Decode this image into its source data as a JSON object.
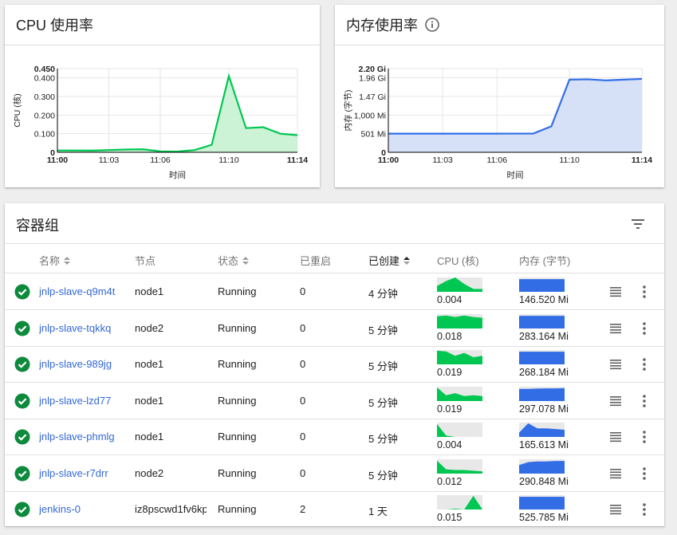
{
  "cpu_card": {
    "title": "CPU 使用率"
  },
  "mem_card": {
    "title": "内存使用率"
  },
  "chart_data": [
    {
      "type": "area",
      "title": "CPU 使用率",
      "xlabel": "时间",
      "ylabel": "CPU (核)",
      "x": [
        "11:00",
        "11:01",
        "11:02",
        "11:03",
        "11:04",
        "11:05",
        "11:06",
        "11:07",
        "11:08",
        "11:09",
        "11:10",
        "11:11",
        "11:12",
        "11:13",
        "11:14"
      ],
      "series": [
        {
          "values": [
            0.01,
            0.01,
            0.009,
            0.012,
            0.015,
            0.016,
            0.005,
            0.004,
            0.012,
            0.04,
            0.41,
            0.13,
            0.135,
            0.1,
            0.092
          ]
        }
      ],
      "yticks": [
        "0",
        "0.100",
        "0.200",
        "0.300",
        "0.400",
        "0.450"
      ],
      "ytick_values": [
        0,
        0.1,
        0.2,
        0.3,
        0.4,
        0.45
      ],
      "xticks": [
        "11:00",
        "11:03",
        "11:06",
        "11:10",
        "11:14"
      ],
      "ylim": [
        0,
        0.45
      ],
      "grid": true,
      "color": "#00c752",
      "fill": "#ccf3d6"
    },
    {
      "type": "area",
      "title": "内存使用率",
      "xlabel": "时间",
      "ylabel": "内存 (字节)",
      "x": [
        "11:00",
        "11:01",
        "11:02",
        "11:03",
        "11:04",
        "11:05",
        "11:06",
        "11:07",
        "11:08",
        "11:09",
        "11:10",
        "11:11",
        "11:12",
        "11:13",
        "11:14"
      ],
      "series": [
        {
          "values": [
            501,
            501,
            501,
            501,
            501,
            501,
            502,
            503,
            503,
            700,
            1955,
            1965,
            1935,
            1955,
            1975
          ]
        }
      ],
      "yticks": [
        "0",
        "501 Mi",
        "1,000 Mi",
        "1.47 Gi",
        "1.96 Gi",
        "2.20 Gi"
      ],
      "ytick_values": [
        0,
        501,
        1000,
        1505,
        2007,
        2253
      ],
      "xticks": [
        "11:00",
        "11:03",
        "11:06",
        "11:10",
        "11:14"
      ],
      "ylim": [
        0,
        2253
      ],
      "grid": true,
      "color": "#326de6",
      "fill": "#d6e1f8"
    }
  ],
  "pods": {
    "title": "容器组",
    "columns": {
      "name": "名称",
      "node": "节点",
      "status": "状态",
      "restarts": "已重启",
      "created": "已创建",
      "cpu": "CPU (核)",
      "memory": "内存 (字节)"
    },
    "colors": {
      "cpu_spark": "#00c752",
      "mem_spark": "#326de6",
      "spark_bg": "#e8e8e8",
      "ok": "#0d8a3c"
    },
    "rows": [
      {
        "name": "jnlp-slave-q9m4t",
        "node": "node1",
        "status": "Running",
        "restarts": "0",
        "created": "4 分钟",
        "cpu": "0.004",
        "memory": "146.520 Mi",
        "cpu_spark": [
          0.4,
          0.75,
          1.0,
          0.55,
          0.2,
          0.2
        ],
        "mem_spark": [
          0.88,
          0.88,
          0.88,
          0.88,
          0.88,
          0.88
        ]
      },
      {
        "name": "jnlp-slave-tqkkq",
        "node": "node2",
        "status": "Running",
        "restarts": "0",
        "created": "5 分钟",
        "cpu": "0.018",
        "memory": "283.164 Mi",
        "cpu_spark": [
          0.85,
          0.9,
          0.8,
          0.9,
          0.8,
          0.75
        ],
        "mem_spark": [
          0.88,
          0.88,
          0.88,
          0.88,
          0.88,
          0.88
        ]
      },
      {
        "name": "jnlp-slave-989jg",
        "node": "node1",
        "status": "Running",
        "restarts": "0",
        "created": "5 分钟",
        "cpu": "0.019",
        "memory": "268.184 Mi",
        "cpu_spark": [
          0.95,
          0.9,
          0.6,
          0.8,
          0.5,
          0.6
        ],
        "mem_spark": [
          0.88,
          0.88,
          0.88,
          0.88,
          0.88,
          0.88
        ]
      },
      {
        "name": "jnlp-slave-lzd77",
        "node": "node1",
        "status": "Running",
        "restarts": "0",
        "created": "5 分钟",
        "cpu": "0.019",
        "memory": "297.078 Mi",
        "cpu_spark": [
          0.95,
          0.4,
          0.55,
          0.35,
          0.4,
          0.35
        ],
        "mem_spark": [
          0.85,
          0.85,
          0.87,
          0.88,
          0.88,
          0.9
        ]
      },
      {
        "name": "jnlp-slave-phmlg",
        "node": "node1",
        "status": "Running",
        "restarts": "0",
        "created": "5 分钟",
        "cpu": "0.004",
        "memory": "165.613 Mi",
        "cpu_spark": [
          0.9,
          0.1,
          0.0,
          0.0,
          0.0,
          0.0
        ],
        "mem_spark": [
          0.3,
          0.95,
          0.6,
          0.6,
          0.55,
          0.5
        ]
      },
      {
        "name": "jnlp-slave-r7drr",
        "node": "node2",
        "status": "Running",
        "restarts": "0",
        "created": "5 分钟",
        "cpu": "0.012",
        "memory": "290.848 Mi",
        "cpu_spark": [
          0.9,
          0.3,
          0.25,
          0.25,
          0.2,
          0.15
        ],
        "mem_spark": [
          0.6,
          0.8,
          0.85,
          0.85,
          0.88,
          0.88
        ]
      },
      {
        "name": "jenkins-0",
        "node": "iz8pscwd1fv6kp",
        "status": "Running",
        "restarts": "2",
        "created": "1 天",
        "cpu": "0.015",
        "memory": "525.785 Mi",
        "cpu_spark": [
          0.0,
          0.0,
          0.05,
          0.0,
          0.95,
          0.0
        ],
        "mem_spark": [
          0.88,
          0.88,
          0.88,
          0.88,
          0.88,
          0.88
        ]
      }
    ]
  }
}
